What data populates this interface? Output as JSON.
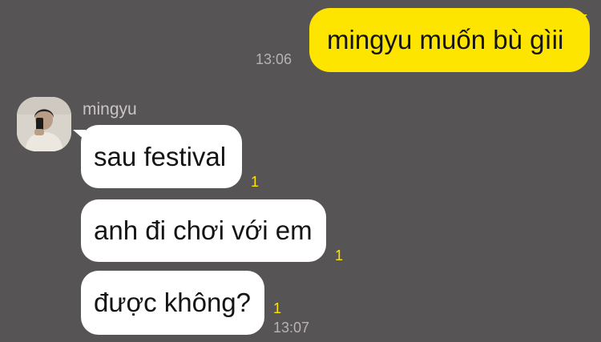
{
  "messages": [
    {
      "direction": "outgoing",
      "text": "mingyu muốn bù gìii",
      "time": "13:06"
    },
    {
      "direction": "incoming",
      "sender": "mingyu",
      "text": "sau festival",
      "unread": "1"
    },
    {
      "direction": "incoming",
      "text": "anh đi chơi với em",
      "unread": "1"
    },
    {
      "direction": "incoming",
      "text": "được không?",
      "unread": "1",
      "time": "13:07"
    }
  ],
  "colors": {
    "background": "#575456",
    "outgoing_bubble": "#fee500",
    "incoming_bubble": "#ffffff",
    "unread_count": "#fee500",
    "timestamp": "#b7b3b5"
  },
  "icons": {
    "avatar": "profile-photo"
  }
}
